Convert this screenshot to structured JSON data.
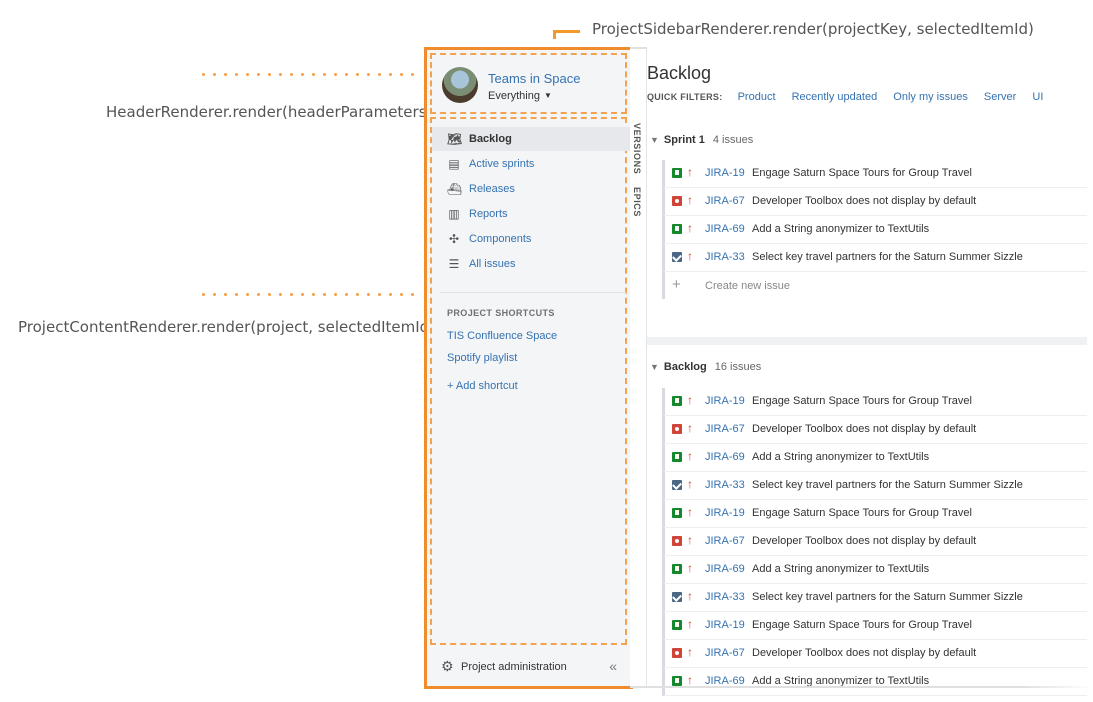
{
  "annotations": {
    "sidebar_renderer": "ProjectSidebarRenderer.render(projectKey, selectedItemId)",
    "header_renderer": "HeaderRenderer.render(headerParameters)",
    "content_renderer": "ProjectContentRenderer.render(project, selectedItemId)",
    "accent_color": "#f08c2b"
  },
  "sidebar": {
    "project_name": "Teams in Space",
    "project_filter": "Everything",
    "nav": [
      {
        "label": "Backlog",
        "icon": "map-icon",
        "active": true
      },
      {
        "label": "Active sprints",
        "icon": "board-icon"
      },
      {
        "label": "Releases",
        "icon": "ship-icon"
      },
      {
        "label": "Reports",
        "icon": "chart-icon"
      },
      {
        "label": "Components",
        "icon": "puzzle-icon"
      },
      {
        "label": "All issues",
        "icon": "list-icon"
      }
    ],
    "shortcuts_title": "PROJECT SHORTCUTS",
    "shortcuts": [
      "TIS Confluence Space",
      "Spotify playlist"
    ],
    "add_shortcut": "+ Add shortcut",
    "footer_label": "Project administration",
    "collapse_symbol": "«"
  },
  "vertical_tabs": [
    "VERSIONS",
    "EPICS"
  ],
  "main": {
    "title": "Backlog",
    "quick_filters_label": "QUICK FILTERS:",
    "quick_filters": [
      "Product",
      "Recently updated",
      "Only my issues",
      "Server",
      "UI"
    ],
    "sprint": {
      "name": "Sprint 1",
      "count": "4 issues",
      "issues": [
        {
          "type": "story",
          "key": "JIRA-19",
          "summary": "Engage Saturn Space Tours for Group Travel"
        },
        {
          "type": "bug",
          "key": "JIRA-67",
          "summary": "Developer Toolbox does not display by default"
        },
        {
          "type": "story",
          "key": "JIRA-69",
          "summary": "Add a String anonymizer to TextUtils"
        },
        {
          "type": "task",
          "key": "JIRA-33",
          "summary": "Select key travel partners for the Saturn Summer Sizzle"
        }
      ],
      "create_label": "Create new issue"
    },
    "backlog": {
      "name": "Backlog",
      "count": "16 issues",
      "issues": [
        {
          "type": "story",
          "key": "JIRA-19",
          "summary": "Engage Saturn Space Tours for Group Travel"
        },
        {
          "type": "bug",
          "key": "JIRA-67",
          "summary": "Developer Toolbox does not display by default"
        },
        {
          "type": "story",
          "key": "JIRA-69",
          "summary": "Add a String anonymizer to TextUtils"
        },
        {
          "type": "task",
          "key": "JIRA-33",
          "summary": "Select key travel partners for the Saturn Summer Sizzle"
        },
        {
          "type": "story",
          "key": "JIRA-19",
          "summary": "Engage Saturn Space Tours for Group Travel"
        },
        {
          "type": "bug",
          "key": "JIRA-67",
          "summary": "Developer Toolbox does not display by default"
        },
        {
          "type": "story",
          "key": "JIRA-69",
          "summary": "Add a String anonymizer to TextUtils"
        },
        {
          "type": "task",
          "key": "JIRA-33",
          "summary": "Select key travel partners for the Saturn Summer Sizzle"
        },
        {
          "type": "story",
          "key": "JIRA-19",
          "summary": "Engage Saturn Space Tours for Group Travel"
        },
        {
          "type": "bug",
          "key": "JIRA-67",
          "summary": "Developer Toolbox does not display by default"
        },
        {
          "type": "story",
          "key": "JIRA-69",
          "summary": "Add a String anonymizer to TextUtils"
        }
      ]
    }
  }
}
